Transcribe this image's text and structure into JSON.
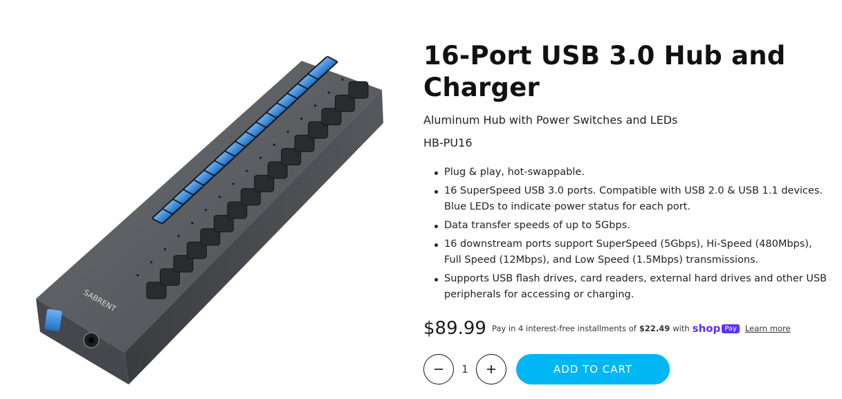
{
  "product": {
    "image_alt": "Sabrent 16-port USB hub",
    "brand_logo": "SABRENT",
    "title": "16-Port USB 3.0 Hub and Charger",
    "subtitle": "Aluminum Hub with Power Switches and LEDs",
    "sku": "HB-PU16",
    "features": [
      "Plug & play, hot-swappable.",
      "16 SuperSpeed USB 3.0 ports. Compatible with USB 2.0 & USB 1.1 devices. Blue LEDs to indicate power status for each port.",
      "Data transfer speeds of up to 5Gbps.",
      "16 downstream ports support SuperSpeed (5Gbps), Hi-Speed (480Mbps), Full Speed (12Mbps), and Low Speed (1.5Mbps) transmissions.",
      "Supports USB flash drives, card readers, external hard drives and other USB peripherals for accessing or charging."
    ]
  },
  "pricing": {
    "price": "$89.99",
    "installment_prefix": "Pay in 4 interest-free installments of",
    "installment_amount": "$22.49",
    "installment_with": "with",
    "shop_logo": "shop",
    "pay_badge": "Pay",
    "learn_more": "Learn more"
  },
  "cart": {
    "quantity": "1",
    "decrease_icon": "minus-icon",
    "increase_icon": "plus-icon",
    "add_to_cart_label": "ADD TO CART"
  },
  "colors": {
    "accent": "#00b6f5",
    "shop_pay": "#5a31f4",
    "usb_port_blue": "#2a7fd4"
  }
}
